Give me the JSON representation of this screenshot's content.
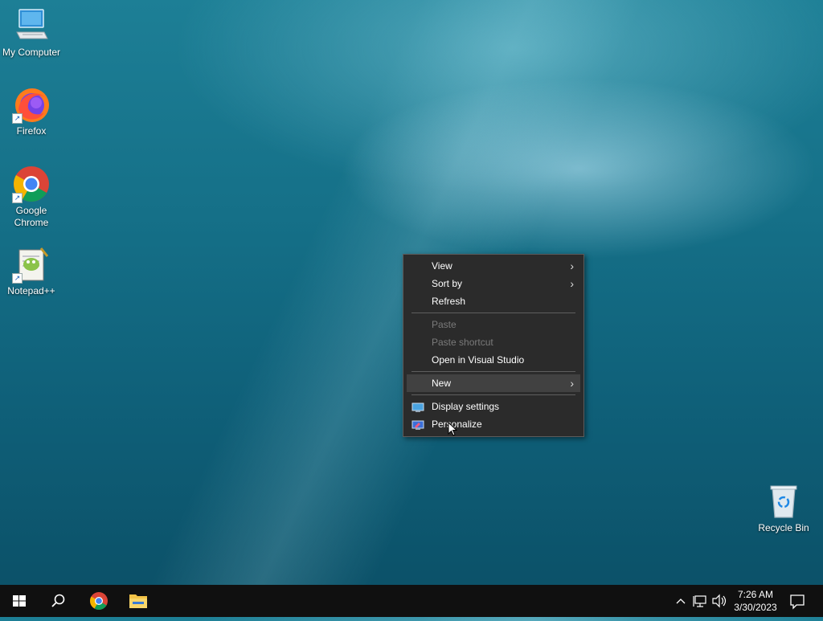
{
  "desktop_icons": [
    {
      "label": "My Computer",
      "icon": "computer-icon"
    },
    {
      "label": "Firefox",
      "icon": "firefox-icon"
    },
    {
      "label": "Google Chrome",
      "icon": "chrome-icon"
    },
    {
      "label": "Notepad++",
      "icon": "notepadpp-icon"
    },
    {
      "label": "Recycle Bin",
      "icon": "recycle-bin-icon"
    }
  ],
  "context_menu": {
    "items": [
      {
        "label": "View",
        "submenu": true,
        "enabled": true
      },
      {
        "label": "Sort by",
        "submenu": true,
        "enabled": true
      },
      {
        "label": "Refresh",
        "enabled": true
      },
      {
        "label": "Paste",
        "enabled": false
      },
      {
        "label": "Paste shortcut",
        "enabled": false
      },
      {
        "label": "Open in Visual Studio",
        "enabled": true
      },
      {
        "label": "New",
        "submenu": true,
        "enabled": true,
        "highlighted": true
      },
      {
        "label": "Display settings",
        "enabled": true,
        "icon": "display-settings-icon"
      },
      {
        "label": "Personalize",
        "enabled": true,
        "icon": "personalize-icon"
      }
    ]
  },
  "taskbar": {
    "clock": {
      "time": "7:26 AM",
      "date": "3/30/2023"
    },
    "colors": {
      "background": "#101010",
      "menu_background": "#2b2b2b"
    }
  }
}
